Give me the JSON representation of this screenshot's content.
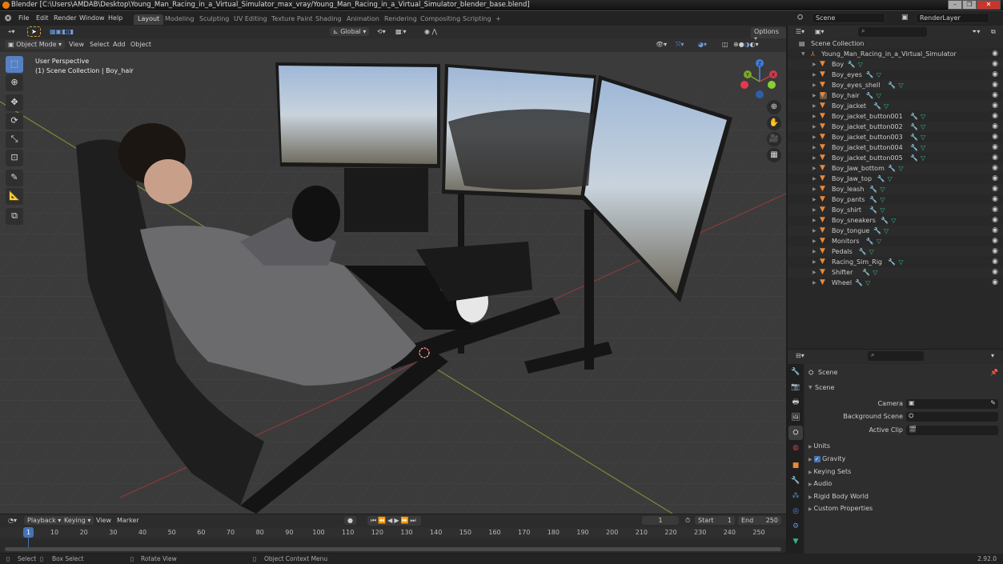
{
  "window": {
    "title": "Blender [C:\\Users\\AMDAB\\Desktop\\Young_Man_Racing_in_a_Virtual_Simulator_max_vray/Young_Man_Racing_in_a_Virtual_Simulator_blender_base.blend]",
    "minimize": "–",
    "maximize": "❐",
    "close": "✕"
  },
  "menu": [
    "File",
    "Edit",
    "Render",
    "Window",
    "Help"
  ],
  "workspaces": [
    "Layout",
    "Modeling",
    "Sculpting",
    "UV Editing",
    "Texture Paint",
    "Shading",
    "Animation",
    "Rendering",
    "Compositing",
    "Scripting",
    "+"
  ],
  "active_workspace": "Layout",
  "scene": {
    "label": "Scene",
    "render_layer": "RenderLayer"
  },
  "viewport": {
    "mode": "Object Mode",
    "menus": [
      "View",
      "Select",
      "Add",
      "Object"
    ],
    "orientation": "Global",
    "options": "Options",
    "info_line1": "User Perspective",
    "info_line2": "(1) Scene Collection | Boy_hair",
    "gizmo": {
      "x": "X",
      "y": "Y",
      "z": "Z"
    }
  },
  "outliner": {
    "root": "Scene Collection",
    "collection": "Young_Man_Racing_in_a_Virtual_Simulator",
    "items": [
      "Boy",
      "Boy_eyes",
      "Boy_eyes_shell",
      "Boy_hair",
      "Boy_jacket",
      "Boy_jacket_button001",
      "Boy_jacket_button002",
      "Boy_jacket_button003",
      "Boy_jacket_button004",
      "Boy_jacket_button005",
      "Boy_Jaw_bottom",
      "Boy_Jaw_top",
      "Boy_leash",
      "Boy_pants",
      "Boy_shirt",
      "Boy_sneakers",
      "Boy_tongue",
      "Monitors",
      "Pedals",
      "Racing_Sim_Rig",
      "Shifter",
      "Wheel"
    ]
  },
  "properties": {
    "context": "Scene",
    "panel": "Scene",
    "camera_label": "Camera",
    "bg_scene_label": "Background Scene",
    "active_clip_label": "Active Clip",
    "sections": [
      "Units",
      "Gravity",
      "Keying Sets",
      "Audio",
      "Rigid Body World",
      "Custom Properties"
    ],
    "gravity_checked": true
  },
  "timeline": {
    "menus": [
      "Playback",
      "Keying",
      "View",
      "Marker"
    ],
    "current_frame": "1",
    "start_label": "Start",
    "start": "1",
    "end_label": "End",
    "end": "250",
    "ticks": [
      "10",
      "20",
      "30",
      "40",
      "50",
      "60",
      "70",
      "80",
      "90",
      "100",
      "110",
      "120",
      "130",
      "140",
      "150",
      "160",
      "170",
      "180",
      "190",
      "200",
      "210",
      "220",
      "230",
      "240",
      "250"
    ]
  },
  "status": {
    "select": "Select",
    "box_select": "Box Select",
    "rotate": "Rotate View",
    "context_menu": "Object Context Menu",
    "version": "2.92.0"
  },
  "colors": {
    "accent": "#4772b3",
    "mesh": "#e8893a",
    "data": "#2fb98a",
    "modifier": "#7b8fc9"
  }
}
